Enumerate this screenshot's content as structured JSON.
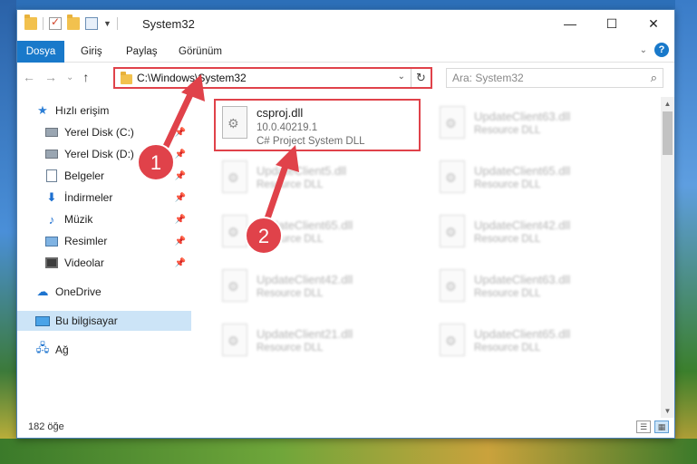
{
  "window": {
    "title": "System32",
    "minimize": "—",
    "maximize": "☐",
    "close": "✕"
  },
  "ribbon": {
    "tabs": [
      "Dosya",
      "Giriş",
      "Paylaş",
      "Görünüm"
    ],
    "help": "?"
  },
  "nav": {
    "back": "←",
    "forward": "→",
    "recent": "⌄",
    "up": "↑",
    "address": "C:\\Windows\\System32",
    "refresh": "↻",
    "search_placeholder": "Ara: System32",
    "search_icon": "⌕"
  },
  "sidebar": {
    "items": [
      {
        "label": "Hızlı erişim",
        "icon": "star-icon",
        "pinned": false
      },
      {
        "label": "Yerel Disk (C:)",
        "icon": "drive-icon",
        "pinned": true
      },
      {
        "label": "Yerel Disk (D:)",
        "icon": "drive-icon",
        "pinned": true
      },
      {
        "label": "Belgeler",
        "icon": "documents-icon",
        "pinned": true
      },
      {
        "label": "İndirmeler",
        "icon": "downloads-icon",
        "pinned": true
      },
      {
        "label": "Müzik",
        "icon": "music-icon",
        "pinned": true
      },
      {
        "label": "Resimler",
        "icon": "pictures-icon",
        "pinned": true
      },
      {
        "label": "Videolar",
        "icon": "videos-icon",
        "pinned": true
      },
      {
        "label": "OneDrive",
        "icon": "cloud-icon",
        "pinned": false
      },
      {
        "label": "Bu bilgisayar",
        "icon": "computer-icon",
        "pinned": false,
        "selected": true
      },
      {
        "label": "Ağ",
        "icon": "network-icon",
        "pinned": false
      }
    ]
  },
  "files": {
    "highlighted": {
      "name": "csproj.dll",
      "version": "10.0.40219.1",
      "description": "C# Project System DLL"
    },
    "left_column": [
      {
        "name": "UpdateClient5.dll",
        "description": "Resource DLL"
      },
      {
        "name": "UpdateClient65.dll",
        "description": "Resource DLL"
      },
      {
        "name": "UpdateClient42.dll",
        "description": "Resource DLL"
      },
      {
        "name": "UpdateClient21.dll",
        "description": "Resource DLL"
      }
    ],
    "right_column": [
      {
        "name": "UpdateClient63.dll",
        "description": "Resource DLL"
      },
      {
        "name": "UpdateClient65.dll",
        "description": "Resource DLL"
      },
      {
        "name": "UpdateClient42.dll",
        "description": "Resource DLL"
      },
      {
        "name": "UpdateClient63.dll",
        "description": "Resource DLL"
      },
      {
        "name": "UpdateClient65.dll",
        "description": "Resource DLL"
      }
    ]
  },
  "status": {
    "count": "182 öğe"
  },
  "annotations": {
    "step1": "1",
    "step2": "2",
    "color": "#e0424a"
  }
}
